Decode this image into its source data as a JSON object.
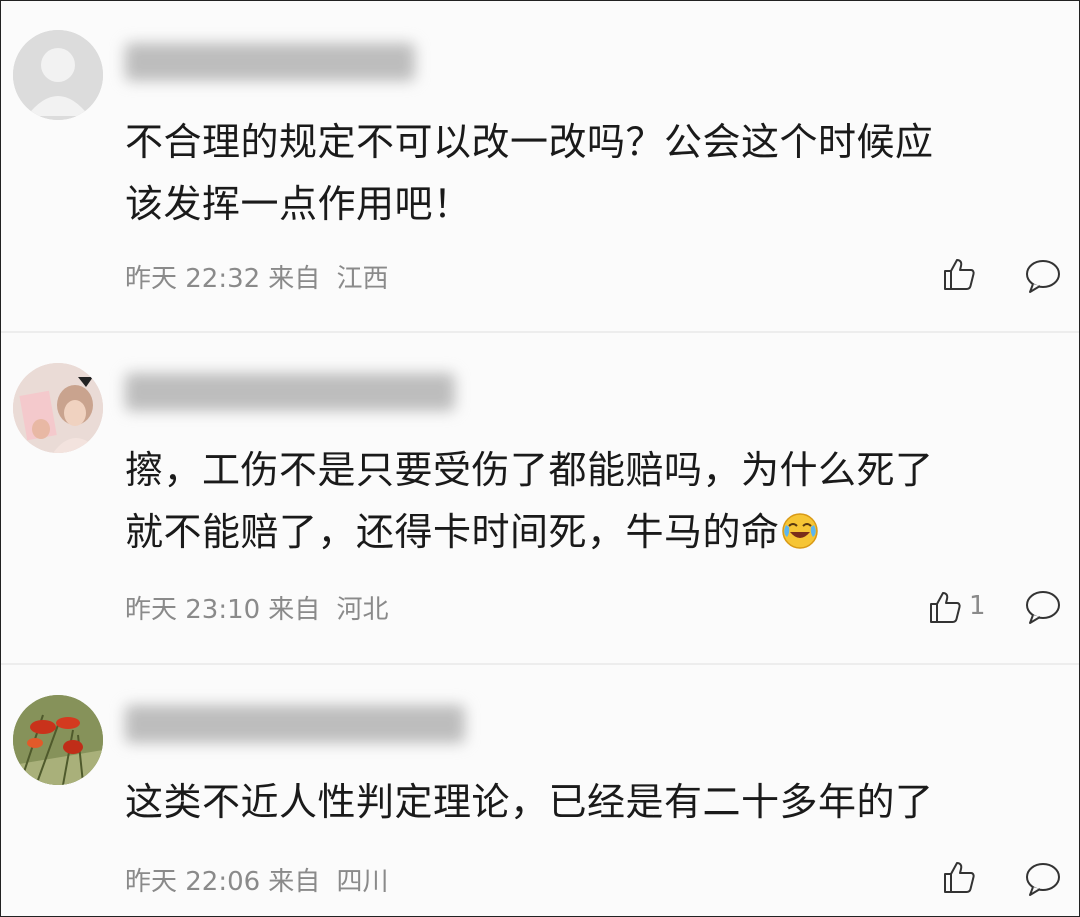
{
  "comments": [
    {
      "username": "",
      "text_line1": "不合理的规定不可以改一改吗？公会这个时候应",
      "text_line2": "该发挥一点作用吧！",
      "time": "昨天 22:32",
      "from_label": "来自",
      "location": "江西",
      "likes": "",
      "avatar_icon": "default-person-avatar-icon"
    },
    {
      "username": "",
      "text_line1": "擦，工伤不是只要受伤了都能赔吗，为什么死了",
      "text_line2": "就不能赔了，还得卡时间死，牛马的命",
      "emoji": "crying-laughing-emoji-icon",
      "time": "昨天 23:10",
      "from_label": "来自",
      "location": "河北",
      "likes": "1",
      "avatar_icon": "photo-avatar-icon"
    },
    {
      "username": "",
      "text_line1": "这类不近人性判定理论，已经是有二十多年的了",
      "time": "昨天 22:06",
      "from_label": "来自",
      "location": "四川",
      "likes": "",
      "avatar_icon": "flower-avatar-icon"
    }
  ],
  "icons": {
    "like": "thumbs-up-icon",
    "reply": "comment-bubble-icon"
  },
  "colors": {
    "text": "#1a1a1a",
    "meta": "#8a8a8a",
    "divider": "#ededed"
  }
}
